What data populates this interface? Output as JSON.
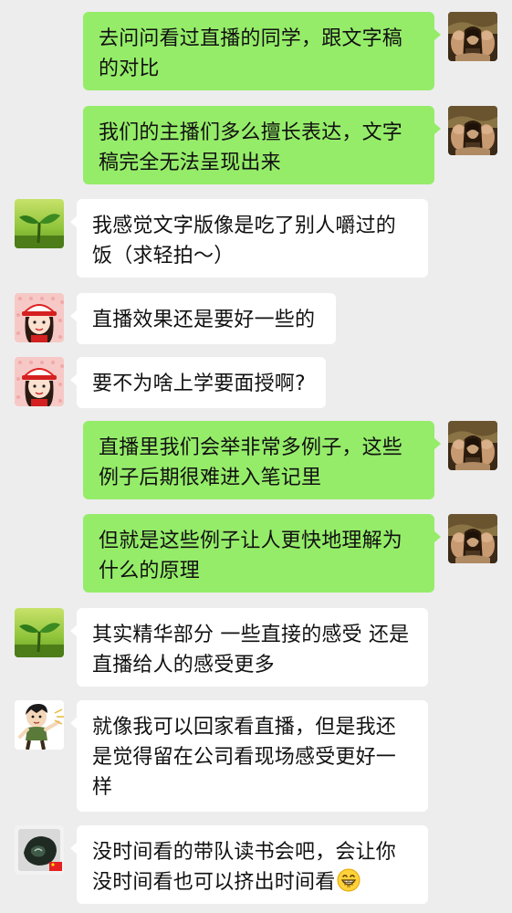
{
  "messages": [
    {
      "side": "out",
      "avatar": "mona-lisa-avatar",
      "text": "去问问看过直播的同学，跟文字稿的对比"
    },
    {
      "side": "out",
      "avatar": "mona-lisa-avatar",
      "text": "我们的主播们多么擅长表达，文字稿完全无法呈现出来"
    },
    {
      "side": "in",
      "avatar": "sprout-avatar",
      "text": "我感觉文字版像是吃了别人嚼过的饭（求轻拍～）"
    },
    {
      "side": "in",
      "avatar": "cartoon-girl-avatar",
      "text": "直播效果还是要好一些的"
    },
    {
      "side": "in",
      "avatar": "cartoon-girl-avatar",
      "text": "要不为啥上学要面授啊?"
    },
    {
      "side": "out",
      "avatar": "mona-lisa-avatar",
      "text": "直播里我们会举非常多例子，这些例子后期很难进入笔记里"
    },
    {
      "side": "out",
      "avatar": "mona-lisa-avatar",
      "text": "但就是这些例子让人更快地理解为什么的原理"
    },
    {
      "side": "in",
      "avatar": "sprout-avatar",
      "text": "其实精华部分 一些直接的感受 还是直播给人的感受更多"
    },
    {
      "side": "in",
      "avatar": "cartoon-boy-avatar",
      "text": "就像我可以回家看直播，但是我还是觉得留在公司看现场感受更好一样"
    },
    {
      "side": "in",
      "avatar": "stone-avatar",
      "text": "没时间看的带队读书会吧，会让你没时间看也可以挤出时间看",
      "emoji": "grinning-face-emoji"
    }
  ],
  "colors": {
    "background": "#ededed",
    "outgoing_bubble": "#95ec69",
    "incoming_bubble": "#ffffff"
  }
}
